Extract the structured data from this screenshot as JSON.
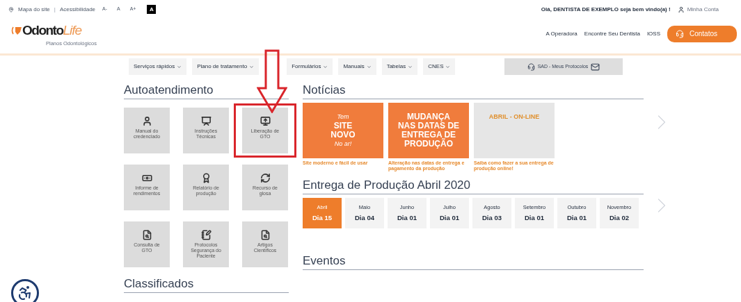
{
  "top_bar": {
    "links": [
      "Mapa do site",
      "Acessibilidade"
    ],
    "separator": "|",
    "font_sizes": [
      "A-",
      "A",
      "A+"
    ],
    "contrast": "A",
    "greeting": "Olá, DENTISTA DE EXEMPLO seja bem vindo(a) !",
    "account": "Minha Conta"
  },
  "logo": {
    "name": "Odonto",
    "accent": "Life",
    "tagline": "Planos Odontológicos"
  },
  "main_nav": {
    "links": [
      "A Operadora",
      "Encontre Seu Dentista",
      "IOSS"
    ],
    "cta": "Contatos"
  },
  "menu": {
    "items": [
      "Serviços rápidos",
      "Plano de tratamento",
      "Formulários",
      "Manuais",
      "Tabelas",
      "CNES"
    ],
    "protocols": "SAD - Meus Protocolos"
  },
  "self_service": {
    "title": "Autoatendimento",
    "tiles": [
      {
        "label": "Manual do credenciado",
        "highlighted": false
      },
      {
        "label": "Instruções Técnicas",
        "highlighted": false
      },
      {
        "label": "Liberação de GTO",
        "highlighted": true
      },
      {
        "label": "Informe de rendimentos",
        "highlighted": false
      },
      {
        "label": "Relatório de produção",
        "highlighted": false
      },
      {
        "label": "Recurso de glosa",
        "highlighted": false
      },
      {
        "label": "Consulta de GTO",
        "highlighted": false
      },
      {
        "label": "Protocolos Segurança do Paciente",
        "highlighted": false
      },
      {
        "label": "Artigos Científicos",
        "highlighted": false
      }
    ]
  },
  "classifieds": {
    "title": "Classificados"
  },
  "news": {
    "title": "Notícias",
    "items": [
      {
        "kind": "orange",
        "lines": [
          "Tem",
          "SITE",
          "NOVO",
          "No ar!"
        ],
        "caption": "Site moderno e fácil de usar"
      },
      {
        "kind": "orange",
        "lines": [
          "MUDANÇA",
          "NAS DATAS DE",
          "ENTREGA DE",
          "PRODUÇÃO"
        ],
        "caption": "Alteração nas datas de entrega e pagamento da produção"
      },
      {
        "kind": "grey",
        "lines": [
          "ABRIL - ON-LINE"
        ],
        "caption": "Saiba como fazer a sua entrega de produção online!"
      }
    ]
  },
  "delivery": {
    "title": "Entrega de Produção Abril 2020",
    "months": [
      {
        "month": "Abril",
        "day": "Dia 15",
        "selected": true
      },
      {
        "month": "Maio",
        "day": "Dia 04",
        "selected": false
      },
      {
        "month": "Junho",
        "day": "Dia 01",
        "selected": false
      },
      {
        "month": "Julho",
        "day": "Dia 01",
        "selected": false
      },
      {
        "month": "Agosto",
        "day": "Dia 03",
        "selected": false
      },
      {
        "month": "Setembro",
        "day": "Dia 01",
        "selected": false
      },
      {
        "month": "Outubro",
        "day": "Dia 01",
        "selected": false
      },
      {
        "month": "Novembro",
        "day": "Dia 02",
        "selected": false
      }
    ]
  },
  "events": {
    "title": "Eventos"
  }
}
